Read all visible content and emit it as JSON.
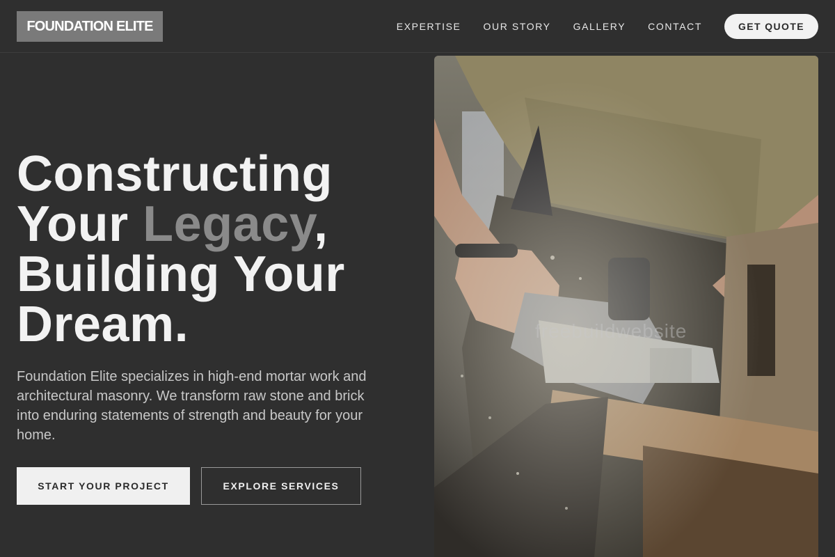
{
  "header": {
    "logo": "FOUNDATION ELITE",
    "nav": [
      "EXPERTISE",
      "OUR STORY",
      "GALLERY",
      "CONTACT"
    ],
    "cta": "GET QUOTE"
  },
  "hero": {
    "title_line1": "Constructing",
    "title_your": "Your ",
    "title_accent": "Legacy",
    "title_comma": ",",
    "title_line3": "Building Your",
    "title_line4": "Dream.",
    "description": "Foundation Elite specializes in high-end mortar work and architectural masonry. We transform raw stone and brick into enduring statements of strength and beauty for your home.",
    "primary_button": "START YOUR PROJECT",
    "secondary_button": "EXPLORE SERVICES"
  },
  "image": {
    "alt": "Worker cutting with power saw",
    "watermark": "freebuildwebsite"
  },
  "colors": {
    "background": "#2f2f2f",
    "accent_text": "#8a8a8a",
    "logo_bg": "#7a7a7a",
    "button_light": "#f0f0f0"
  }
}
